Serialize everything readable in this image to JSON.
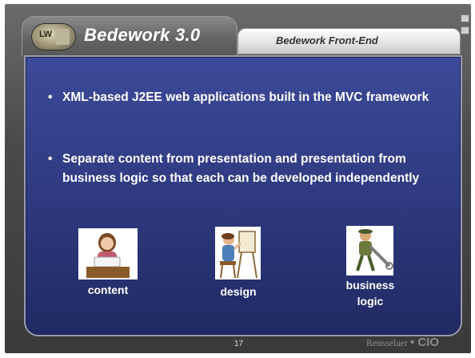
{
  "slide": {
    "title": "Bedework 3.0",
    "subtitle": "Bedework Front-End",
    "logo_text": "LW",
    "bullets": [
      {
        "marker": "•",
        "text": "XML-based J2EE web applications built in the MVC framework"
      },
      {
        "marker": "•",
        "text": "Separate content from presentation and presentation from business logic so that each can be developed independently"
      }
    ],
    "figures": [
      {
        "label": "content",
        "icon": "person-reading-icon"
      },
      {
        "label": "design",
        "icon": "painter-at-easel-icon"
      },
      {
        "label": "business logic",
        "icon": "person-with-wrench-icon"
      }
    ],
    "page_number": "17",
    "footer_brand": "Rensselaer",
    "footer_brand_suffix": "• CIO"
  },
  "colors": {
    "panel_top": "#3c4a99",
    "panel_bottom": "#212a63",
    "frame": "#4a4a4a",
    "text": "#ffffff"
  }
}
